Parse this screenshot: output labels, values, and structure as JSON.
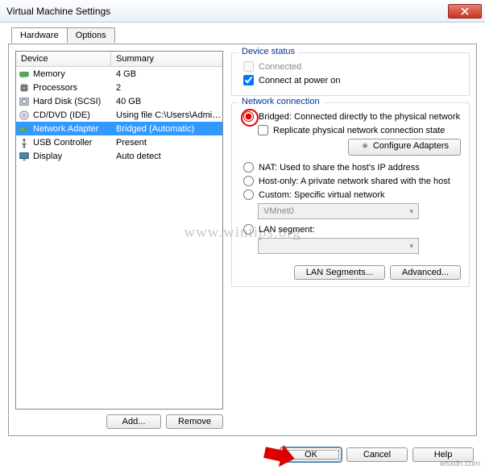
{
  "window": {
    "title": "Virtual Machine Settings"
  },
  "tabs": {
    "hardware": "Hardware",
    "options": "Options"
  },
  "columns": {
    "device": "Device",
    "summary": "Summary"
  },
  "devices": [
    {
      "name": "Memory",
      "summary": "4 GB",
      "icon": "memory"
    },
    {
      "name": "Processors",
      "summary": "2",
      "icon": "cpu"
    },
    {
      "name": "Hard Disk (SCSI)",
      "summary": "40 GB",
      "icon": "disk"
    },
    {
      "name": "CD/DVD (IDE)",
      "summary": "Using file C:\\Users\\Admin\\Do...",
      "icon": "cd"
    },
    {
      "name": "Network Adapter",
      "summary": "Bridged (Automatic)",
      "icon": "net",
      "selected": true
    },
    {
      "name": "USB Controller",
      "summary": "Present",
      "icon": "usb"
    },
    {
      "name": "Display",
      "summary": "Auto detect",
      "icon": "display"
    }
  ],
  "leftButtons": {
    "add": "Add...",
    "remove": "Remove"
  },
  "groups": {
    "status": {
      "legend": "Device status",
      "connected": "Connected",
      "connectPowerOn": "Connect at power on"
    },
    "net": {
      "legend": "Network connection",
      "bridged": "Bridged: Connected directly to the physical network",
      "replicate": "Replicate physical network connection state",
      "configure": "Configure Adapters",
      "nat": "NAT: Used to share the host's IP address",
      "hostonly": "Host-only: A private network shared with the host",
      "custom": "Custom: Specific virtual network",
      "customValue": "VMnet0",
      "lanseg": "LAN segment:",
      "lansegBtn": "LAN Segments...",
      "advanced": "Advanced..."
    }
  },
  "footer": {
    "ok": "OK",
    "cancel": "Cancel",
    "help": "Help"
  },
  "watermark": {
    "big": "www.wintips.org",
    "small": "wsxdn.com"
  }
}
